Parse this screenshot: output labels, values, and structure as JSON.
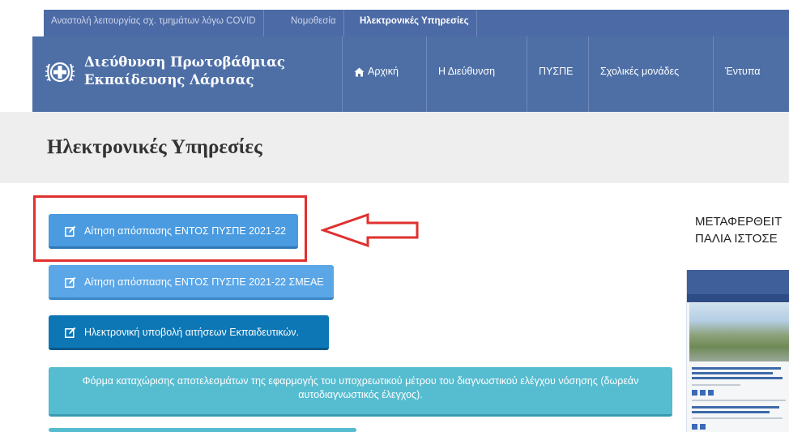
{
  "topbar": {
    "links": [
      {
        "label": "Αναστολή λειτουργίας σχ. τμημάτων λόγω COVID"
      },
      {
        "label": "Νομοθεσία"
      },
      {
        "label": "Ηλεκτρονικές Υπηρεσίες"
      }
    ]
  },
  "header": {
    "title_line1": "Διεύθυνση Πρωτοβάθμιας",
    "title_line2": "Εκπαίδευσης Λάρισας",
    "nav": [
      {
        "label": "Αρχική",
        "icon": "home-icon"
      },
      {
        "label": "Η Διεύθυνση"
      },
      {
        "label": "ΠΥΣΠΕ"
      },
      {
        "label": "Σχολικές μονάδες"
      },
      {
        "label": "Έντυπα"
      }
    ]
  },
  "page": {
    "title": "Ηλεκτρονικές Υπηρεσίες"
  },
  "buttons": [
    {
      "label": "Αίτηση απόσπασης ΕΝΤΟΣ ΠΥΣΠΕ 2021-22",
      "icon": "edit-icon"
    },
    {
      "label": "Αίτηση απόσπασης ΕΝΤΟΣ ΠΥΣΠΕ 2021-22 ΣΜΕΑΕ",
      "icon": "edit-icon"
    },
    {
      "label": "Ηλεκτρονική υποβολή αιτήσεων Εκπαιδευτικών.",
      "icon": "edit-icon"
    },
    {
      "label": "Φόρμα καταχώρισης αποτελεσμάτων της εφαρμογής του υποχρεωτικού μέτρου του διαγνωστικού ελέγχου νόσησης (δωρεάν αυτοδιαγνωστικός έλεγχος)."
    }
  ],
  "sidebar": {
    "heading_line1": "ΜΕΤΑΦΕΡΘΕΙΤ",
    "heading_line2": "ΠΑΛΙΑ ΙΣΤΟΣΕ"
  },
  "colors": {
    "nav_blue": "#4e6fa6",
    "highlight_red": "#e0302e",
    "button_blue": "#4a9be0",
    "button_dark": "#0d77b5",
    "button_teal": "#56bcd0"
  }
}
